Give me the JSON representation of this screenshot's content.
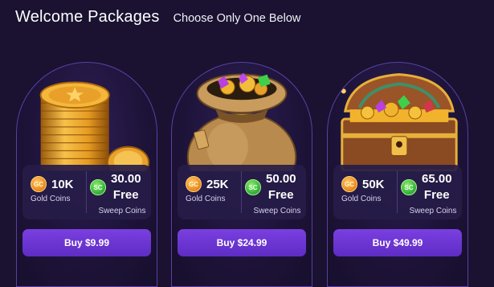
{
  "header": {
    "title": "Welcome Packages",
    "subtitle": "Choose Only One Below"
  },
  "packages": [
    {
      "art": "gold-coin-stack",
      "gold_amount": "10K",
      "gold_label": "Gold Coins",
      "sweep_amount": "30.00",
      "sweep_free": "Free",
      "sweep_label": "Sweep Coins",
      "buy_label": "Buy $9.99"
    },
    {
      "art": "treasure-sack",
      "gold_amount": "25K",
      "gold_label": "Gold Coins",
      "sweep_amount": "50.00",
      "sweep_free": "Free",
      "sweep_label": "Sweep Coins",
      "buy_label": "Buy $24.99"
    },
    {
      "art": "treasure-chest",
      "gold_amount": "50K",
      "gold_label": "Gold Coins",
      "sweep_amount": "65.00",
      "sweep_free": "Free",
      "sweep_label": "Sweep Coins",
      "buy_label": "Buy $49.99"
    }
  ],
  "coin_badges": {
    "gold": "GC",
    "sweep": "SC"
  },
  "colors": {
    "background": "#1a1230",
    "card_border": "#5a3fa6",
    "button": "#6a33d2",
    "gold_coin": "#e88617",
    "sweep_coin": "#2fa93a"
  }
}
